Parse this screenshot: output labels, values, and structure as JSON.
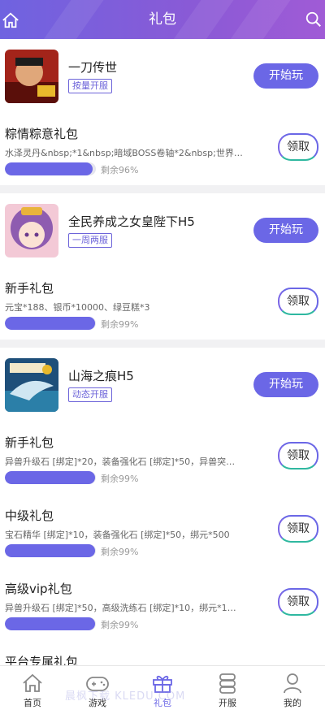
{
  "header": {
    "title": "礼包"
  },
  "games": [
    {
      "name": "一刀传世",
      "tag": "按量开服",
      "play_label": "开始玩",
      "gifts": [
        {
          "name": "粽情粽意礼包",
          "desc": "水泽灵丹&nbsp;*1&nbsp;暗域BOSS卷轴*2&nbsp;世界…",
          "remain": "剩余96%",
          "progress": 0.96,
          "action": "领取"
        }
      ]
    },
    {
      "name": "全民养成之女皇陛下H5",
      "tag": "一周两服",
      "play_label": "开始玩",
      "gifts": [
        {
          "name": "新手礼包",
          "desc": "元宝*188、银币*10000、绿豆糕*3",
          "remain": "剩余99%",
          "progress": 0.99,
          "action": "领取"
        }
      ]
    },
    {
      "name": "山海之痕H5",
      "tag": "动态开服",
      "play_label": "开始玩",
      "gifts": [
        {
          "name": "新手礼包",
          "desc": "异兽升级石 [绑定]*20，装备强化石 [绑定]*50，异兽突…",
          "remain": "剩余99%",
          "progress": 0.99,
          "action": "领取"
        },
        {
          "name": "中级礼包",
          "desc": "宝石精华 [绑定]*10，装备强化石 [绑定]*50，绑元*500",
          "remain": "剩余99%",
          "progress": 0.99,
          "action": "领取"
        },
        {
          "name": "高级vip礼包",
          "desc": "异兽升级石 [绑定]*50，高级洗练石 [绑定]*10，绑元*1…",
          "remain": "剩余99%",
          "progress": 0.99,
          "action": "领取"
        },
        {
          "name": "平台专属礼包",
          "desc": "",
          "remain": "",
          "progress": null,
          "action": ""
        }
      ]
    }
  ],
  "tabbar": {
    "items": [
      {
        "label": "首页",
        "icon": "home-icon"
      },
      {
        "label": "游戏",
        "icon": "gamepad-icon"
      },
      {
        "label": "礼包",
        "icon": "gift-icon",
        "active": true
      },
      {
        "label": "开服",
        "icon": "server-icon"
      },
      {
        "label": "我的",
        "icon": "user-icon"
      }
    ]
  },
  "watermark": "晨枫下载 KLEDU.COM",
  "colors": {
    "accent": "#6b67e6",
    "header_gradient_start": "#6f63e0",
    "header_gradient_end": "#a05bd6"
  }
}
